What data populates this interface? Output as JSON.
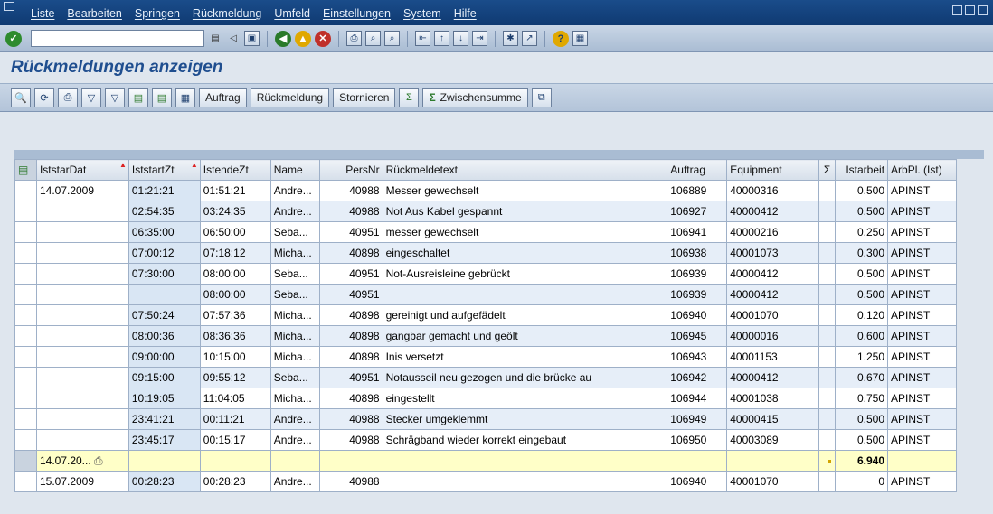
{
  "menubar": {
    "items": [
      "Liste",
      "Bearbeiten",
      "Springen",
      "Rückmeldung",
      "Umfeld",
      "Einstellungen",
      "System",
      "Hilfe"
    ]
  },
  "command_field": {
    "value": ""
  },
  "title": "Rückmeldungen anzeigen",
  "app_toolbar": {
    "buttons": [
      "Auftrag",
      "Rückmeldung",
      "Stornieren",
      "Zwischensumme"
    ]
  },
  "grid": {
    "columns": [
      "IststarDat",
      "IststartZt",
      "IstendeZt",
      "Name",
      "PersNr",
      "Rückmeldetext",
      "Auftrag",
      "Equipment",
      "Σ",
      "Istarbeit",
      "ArbPl. (Ist)"
    ],
    "rows": [
      {
        "date": "14.07.2009",
        "start": "01:21:21",
        "end": "01:51:21",
        "name": "Andre...",
        "persnr": "40988",
        "text": "Messer gewechselt",
        "auftrag": "106889",
        "equipment": "40000316",
        "istarbeit": "0.500",
        "arbpl": "APINST"
      },
      {
        "date": "",
        "start": "02:54:35",
        "end": "03:24:35",
        "name": "Andre...",
        "persnr": "40988",
        "text": "Not Aus Kabel gespannt",
        "auftrag": "106927",
        "equipment": "40000412",
        "istarbeit": "0.500",
        "arbpl": "APINST"
      },
      {
        "date": "",
        "start": "06:35:00",
        "end": "06:50:00",
        "name": "Seba...",
        "persnr": "40951",
        "text": "messer gewechselt",
        "auftrag": "106941",
        "equipment": "40000216",
        "istarbeit": "0.250",
        "arbpl": "APINST"
      },
      {
        "date": "",
        "start": "07:00:12",
        "end": "07:18:12",
        "name": "Micha...",
        "persnr": "40898",
        "text": "eingeschaltet",
        "auftrag": "106938",
        "equipment": "40001073",
        "istarbeit": "0.300",
        "arbpl": "APINST"
      },
      {
        "date": "",
        "start": "07:30:00",
        "end": "08:00:00",
        "name": "Seba...",
        "persnr": "40951",
        "text": "Not-Ausreisleine gebrückt",
        "auftrag": "106939",
        "equipment": "40000412",
        "istarbeit": "0.500",
        "arbpl": "APINST"
      },
      {
        "date": "",
        "start": "",
        "end": "08:00:00",
        "name": "Seba...",
        "persnr": "40951",
        "text": "",
        "auftrag": "106939",
        "equipment": "40000412",
        "istarbeit": "0.500",
        "arbpl": "APINST"
      },
      {
        "date": "",
        "start": "07:50:24",
        "end": "07:57:36",
        "name": "Micha...",
        "persnr": "40898",
        "text": "gereinigt und aufgefädelt",
        "auftrag": "106940",
        "equipment": "40001070",
        "istarbeit": "0.120",
        "arbpl": "APINST"
      },
      {
        "date": "",
        "start": "08:00:36",
        "end": "08:36:36",
        "name": "Micha...",
        "persnr": "40898",
        "text": "gangbar gemacht und geölt",
        "auftrag": "106945",
        "equipment": "40000016",
        "istarbeit": "0.600",
        "arbpl": "APINST"
      },
      {
        "date": "",
        "start": "09:00:00",
        "end": "10:15:00",
        "name": "Micha...",
        "persnr": "40898",
        "text": "Inis versetzt",
        "auftrag": "106943",
        "equipment": "40001153",
        "istarbeit": "1.250",
        "arbpl": "APINST"
      },
      {
        "date": "",
        "start": "09:15:00",
        "end": "09:55:12",
        "name": "Seba...",
        "persnr": "40951",
        "text": "Notausseil neu gezogen und die brücke au",
        "auftrag": "106942",
        "equipment": "40000412",
        "istarbeit": "0.670",
        "arbpl": "APINST"
      },
      {
        "date": "",
        "start": "10:19:05",
        "end": "11:04:05",
        "name": "Micha...",
        "persnr": "40898",
        "text": "eingestellt",
        "auftrag": "106944",
        "equipment": "40001038",
        "istarbeit": "0.750",
        "arbpl": "APINST"
      },
      {
        "date": "",
        "start": "23:41:21",
        "end": "00:11:21",
        "name": "Andre...",
        "persnr": "40988",
        "text": "Stecker umgeklemmt",
        "auftrag": "106949",
        "equipment": "40000415",
        "istarbeit": "0.500",
        "arbpl": "APINST"
      },
      {
        "date": "",
        "start": "23:45:17",
        "end": "00:15:17",
        "name": "Andre...",
        "persnr": "40988",
        "text": "Schrägband wieder korrekt eingebaut",
        "auftrag": "106950",
        "equipment": "40003089",
        "istarbeit": "0.500",
        "arbpl": "APINST"
      }
    ],
    "subtotal": {
      "date": "14.07.20...",
      "istarbeit": "6.940"
    },
    "rows2": [
      {
        "date": "15.07.2009",
        "start": "00:28:23",
        "end": "00:28:23",
        "name": "Andre...",
        "persnr": "40988",
        "text": "",
        "auftrag": "106940",
        "equipment": "40001070",
        "istarbeit": "0",
        "arbpl": "APINST"
      }
    ]
  }
}
